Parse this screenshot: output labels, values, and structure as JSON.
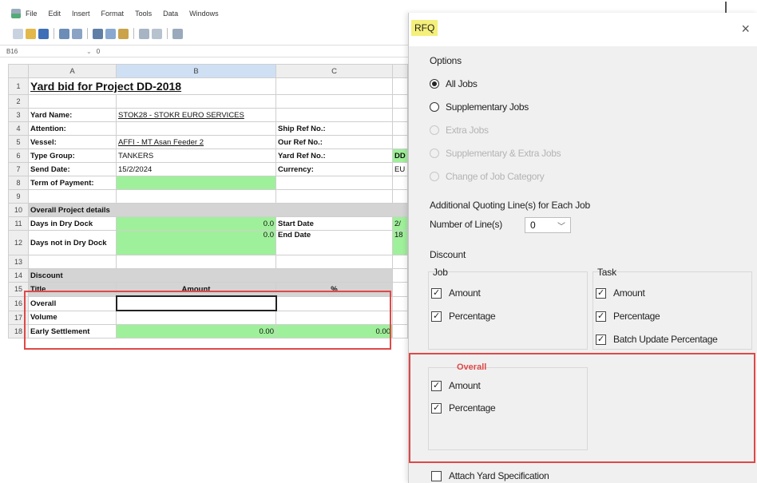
{
  "menubar": {
    "items": [
      "File",
      "Edit",
      "Insert",
      "Format",
      "Tools",
      "Data",
      "Windows"
    ]
  },
  "formula_bar": {
    "cell_ref": "B16",
    "value": "0"
  },
  "sheet": {
    "columns": [
      "A",
      "B",
      "C"
    ],
    "title": "Yard bid for Project DD-2018",
    "yard_name_label": "Yard Name:",
    "yard_name_value": "STOK28 - STOKR EURO SERVICES",
    "attention_label": "Attention:",
    "ship_ref_label": "Ship Ref No.:",
    "vessel_label": "Vessel:",
    "vessel_value": "AFFI - MT Asan Feeder 2",
    "our_ref_label": "Our Ref No.:",
    "type_group_label": "Type Group:",
    "type_group_value": "TANKERS",
    "yard_ref_label": "Yard Ref No.:",
    "yard_ref_value": "DD",
    "send_date_label": "Send Date:",
    "send_date_value": "15/2/2024",
    "currency_label": "Currency:",
    "currency_value": "EU",
    "payment_label": "Term of Payment:",
    "overall_details_label": "Overall Project details",
    "days_dock_label": "Days in Dry Dock",
    "days_dock_value": "0.0",
    "start_date_label": "Start Date",
    "start_date_value": "2/",
    "days_not_dock_label": "Days not in Dry Dock",
    "days_not_dock_value": "0.0",
    "end_date_label": "End Date",
    "end_date_value": "18",
    "discount_label": "Discount",
    "title_col": "Title",
    "amount_col": "Amount",
    "percent_col": "%",
    "overall_row": "Overall",
    "volume_row": "Volume",
    "early_label": "Early Settlement",
    "early_amount": "0.00",
    "early_percent": "0.00"
  },
  "dialog": {
    "title": "RFQ",
    "close": "×",
    "options_label": "Options",
    "options": [
      "All Jobs",
      "Supplementary Jobs",
      "Extra Jobs",
      "Supplementary & Extra Jobs",
      "Change of Job Category"
    ],
    "quoting_label": "Additional Quoting Line(s) for Each Job",
    "lines_label": "Number of Line(s)",
    "lines_value": "0",
    "discount_label": "Discount",
    "job_label": "Job",
    "task_label": "Task",
    "amount": "Amount",
    "percentage": "Percentage",
    "batch_update": "Batch Update Percentage",
    "overall_label": "Overall",
    "attach_spec": "Attach Yard Specification"
  }
}
